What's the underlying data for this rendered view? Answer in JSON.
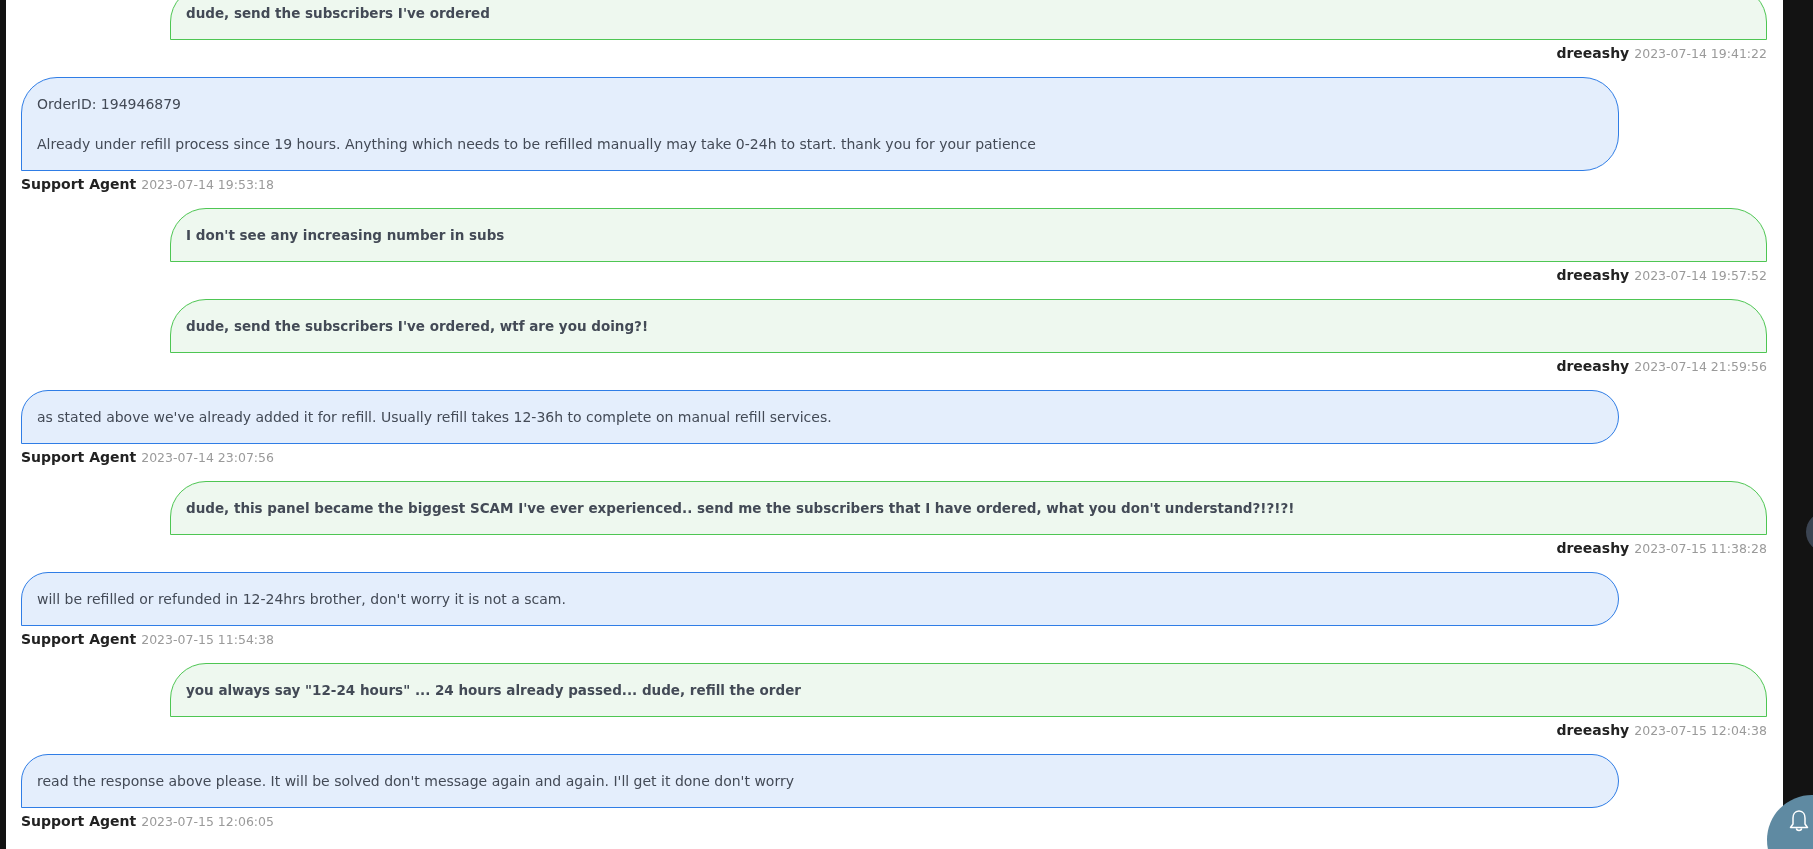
{
  "messages": [
    {
      "kind": "user",
      "paragraphs": [
        "dude, send the subscribers I've ordered"
      ],
      "author": "dreeashy",
      "time": "2023-07-14 19:41:22"
    },
    {
      "kind": "agent",
      "paragraphs": [
        "OrderID: 194946879",
        "Already under refill process since 19 hours. Anything which needs to be refilled manually may take 0-24h to start. thank you for your patience"
      ],
      "author": "Support Agent",
      "time": "2023-07-14 19:53:18"
    },
    {
      "kind": "user",
      "paragraphs": [
        "I don't see any increasing number in subs"
      ],
      "author": "dreeashy",
      "time": "2023-07-14 19:57:52"
    },
    {
      "kind": "user",
      "paragraphs": [
        "dude, send the subscribers I've ordered, wtf are you doing?!"
      ],
      "author": "dreeashy",
      "time": "2023-07-14 21:59:56"
    },
    {
      "kind": "agent",
      "paragraphs": [
        "as stated above we've already added it for refill. Usually refill takes 12-36h to complete on manual refill services."
      ],
      "author": "Support Agent",
      "time": "2023-07-14 23:07:56"
    },
    {
      "kind": "user",
      "paragraphs": [
        "dude, this panel became the biggest SCAM I've ever experienced.. send me the subscribers that I have ordered, what you don't understand?!?!?!"
      ],
      "author": "dreeashy",
      "time": "2023-07-15 11:38:28"
    },
    {
      "kind": "agent",
      "paragraphs": [
        "will be refilled or refunded in 12-24hrs brother, don't worry it is not a scam."
      ],
      "author": "Support Agent",
      "time": "2023-07-15 11:54:38"
    },
    {
      "kind": "user",
      "paragraphs": [
        "you always say \"12-24 hours\" ... 24 hours already passed... dude, refill the order"
      ],
      "author": "dreeashy",
      "time": "2023-07-15 12:04:38"
    },
    {
      "kind": "agent",
      "paragraphs": [
        "read the response above please. It will be solved don't message again and again. I'll get it done don't worry"
      ],
      "author": "Support Agent",
      "time": "2023-07-15 12:06:05"
    }
  ]
}
